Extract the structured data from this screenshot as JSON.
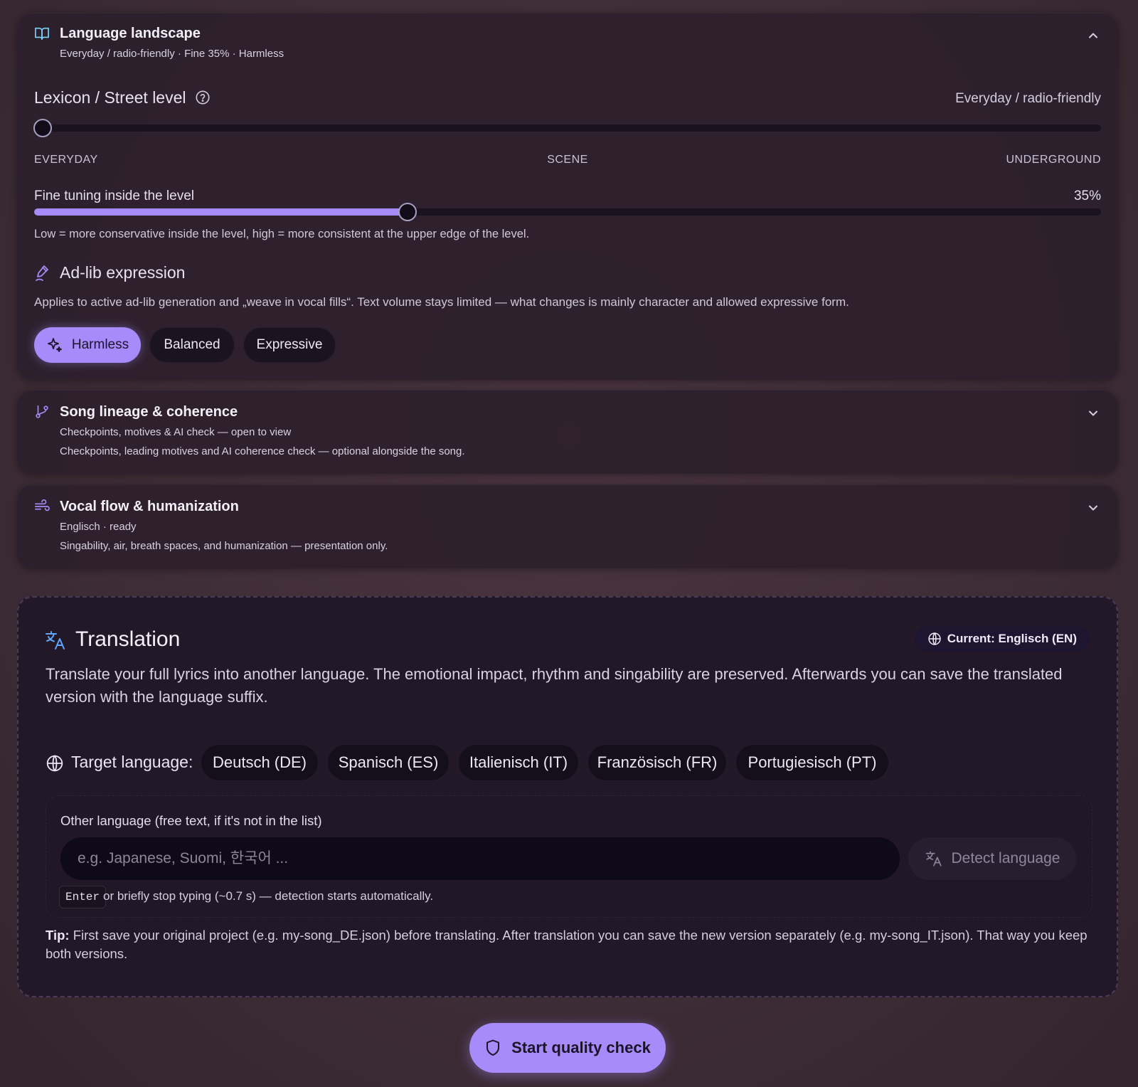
{
  "language_landscape": {
    "title": "Language landscape",
    "subtitle": "Everyday / radio-friendly · Fine 35% · Harmless",
    "lexicon": {
      "title": "Lexicon / Street level",
      "value": "Everyday / radio-friendly",
      "level_fraction": 0,
      "ticks": [
        "EVERYDAY",
        "SCENE",
        "UNDERGROUND"
      ]
    },
    "fine_tuning": {
      "title": "Fine tuning inside the level",
      "value": "35%",
      "fraction": 0.35,
      "help": "Low = more conservative inside the level, high = more consistent at the upper edge of the level."
    },
    "adlib": {
      "title": "Ad-lib expression",
      "description": "Applies to active ad-lib generation and „weave in vocal fills“. Text volume stays limited — what changes is mainly character and allowed expressive form.",
      "options": [
        "Harmless",
        "Balanced",
        "Expressive"
      ],
      "selected": "Harmless"
    }
  },
  "song_lineage": {
    "title": "Song lineage & coherence",
    "subtitle": "Checkpoints, motives & AI check — open to view",
    "description": "Checkpoints, leading motives and AI coherence check — optional alongside the song."
  },
  "vocal_flow": {
    "title": "Vocal flow & humanization",
    "subtitle": "Englisch · ready",
    "description": "Singability, air, breath spaces, and humanization — presentation only."
  },
  "translation": {
    "title": "Translation",
    "current_badge": "Current: Englisch (EN)",
    "description": "Translate your full lyrics into another language. The emotional impact, rhythm and singability are preserved. Afterwards you can save the translated version with the language suffix.",
    "target_label": "Target language:",
    "languages": [
      "Deutsch (DE)",
      "Spanisch (ES)",
      "Italienisch (IT)",
      "Französisch (FR)",
      "Portugiesisch (PT)"
    ],
    "other_label": "Other language (free text, if it's not in the list)",
    "other_placeholder": "e.g. Japanese, Suomi, 한국어 ...",
    "other_value": "",
    "detect_label": "Detect language",
    "enter_key": "Enter",
    "enter_hint": "or briefly stop typing (~0.7 s) — detection starts automatically.",
    "tip_label": "Tip:",
    "tip_text": "First save your original project (e.g. my-song_DE.json) before translating. After translation you can save the new version separately (e.g. my-song_IT.json). That way you keep both versions."
  },
  "quality_check_label": "Start quality check",
  "colors": {
    "accent": "#a78bfa",
    "panel": "#2c1f2c",
    "background": "#3d2c35"
  }
}
